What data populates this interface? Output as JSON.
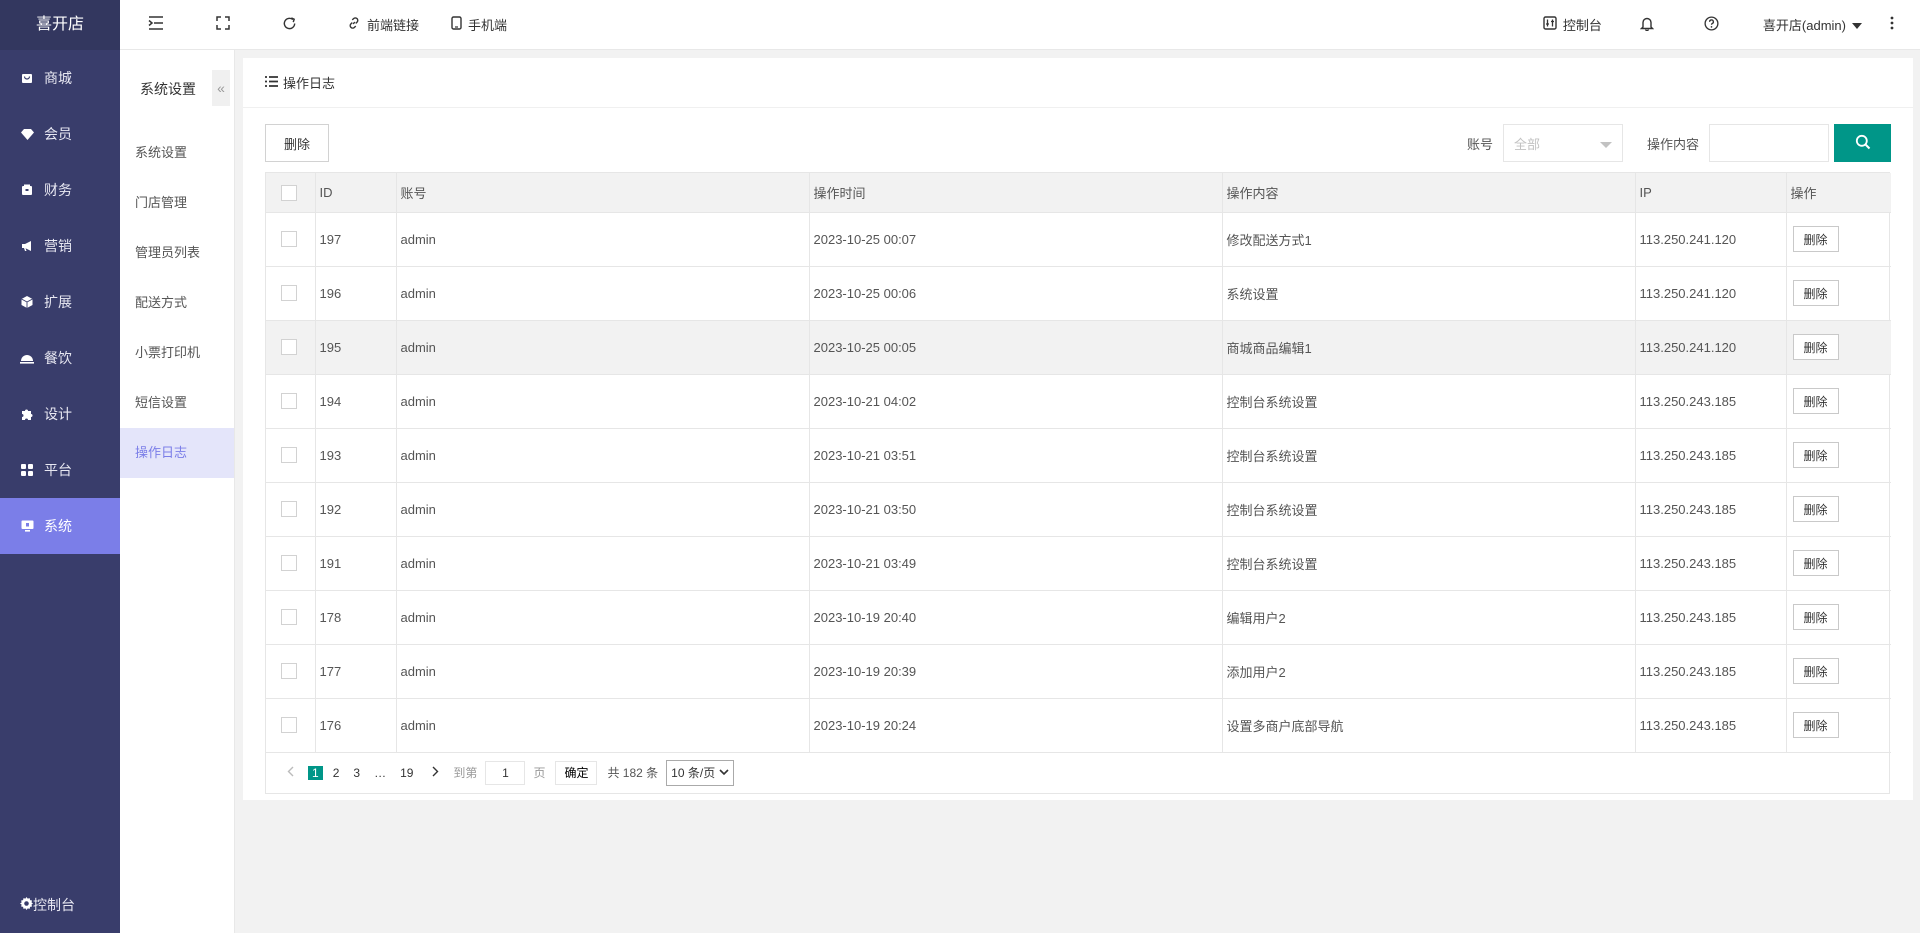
{
  "sidebar": {
    "brand": "喜开店",
    "items": [
      {
        "label": "商城",
        "icon": "shop-icon"
      },
      {
        "label": "会员",
        "icon": "diamond-icon"
      },
      {
        "label": "财务",
        "icon": "wallet-icon"
      },
      {
        "label": "营销",
        "icon": "megaphone-icon"
      },
      {
        "label": "扩展",
        "icon": "cube-icon"
      },
      {
        "label": "餐饮",
        "icon": "dish-icon"
      },
      {
        "label": "设计",
        "icon": "puzzle-icon"
      },
      {
        "label": "平台",
        "icon": "grid-icon"
      },
      {
        "label": "系统",
        "icon": "monitor-icon",
        "active": true
      }
    ],
    "bottom_label": "控制台"
  },
  "subnav": {
    "title": "系统设置",
    "collapse_glyph": "«",
    "items": [
      "系统设置",
      "门店管理",
      "管理员列表",
      "配送方式",
      "小票打印机",
      "短信设置",
      "操作日志"
    ],
    "active": "操作日志"
  },
  "topbar": {
    "frontend_link": "前端链接",
    "mobile": "手机端",
    "console": "控制台",
    "user": "喜开店(admin)"
  },
  "page": {
    "title": "操作日志",
    "delete_button": "删除",
    "filter_account_label": "账号",
    "filter_account_value": "全部",
    "filter_content_label": "操作内容"
  },
  "table": {
    "headers": [
      "",
      "ID",
      "账号",
      "操作时间",
      "操作内容",
      "IP",
      "操作"
    ],
    "row_action": "删除",
    "rows": [
      {
        "id": "197",
        "account": "admin",
        "time": "2023-10-25 00:07",
        "content": "修改配送方式1",
        "ip": "113.250.241.120"
      },
      {
        "id": "196",
        "account": "admin",
        "time": "2023-10-25 00:06",
        "content": "系统设置",
        "ip": "113.250.241.120"
      },
      {
        "id": "195",
        "account": "admin",
        "time": "2023-10-25 00:05",
        "content": "商城商品编辑1",
        "ip": "113.250.241.120"
      },
      {
        "id": "194",
        "account": "admin",
        "time": "2023-10-21 04:02",
        "content": "控制台系统设置",
        "ip": "113.250.243.185"
      },
      {
        "id": "193",
        "account": "admin",
        "time": "2023-10-21 03:51",
        "content": "控制台系统设置",
        "ip": "113.250.243.185"
      },
      {
        "id": "192",
        "account": "admin",
        "time": "2023-10-21 03:50",
        "content": "控制台系统设置",
        "ip": "113.250.243.185"
      },
      {
        "id": "191",
        "account": "admin",
        "time": "2023-10-21 03:49",
        "content": "控制台系统设置",
        "ip": "113.250.243.185"
      },
      {
        "id": "178",
        "account": "admin",
        "time": "2023-10-19 20:40",
        "content": "编辑用户2",
        "ip": "113.250.243.185"
      },
      {
        "id": "177",
        "account": "admin",
        "time": "2023-10-19 20:39",
        "content": "添加用户2",
        "ip": "113.250.243.185"
      },
      {
        "id": "176",
        "account": "admin",
        "time": "2023-10-19 20:24",
        "content": "设置多商户底部导航",
        "ip": "113.250.243.185"
      }
    ]
  },
  "pager": {
    "pages": [
      "1",
      "2",
      "3",
      "…",
      "19"
    ],
    "current": "1",
    "goto_label": "到第",
    "goto_value": "1",
    "page_unit": "页",
    "confirm": "确定",
    "total": "共 182 条",
    "page_size": "10 条/页"
  },
  "colors": {
    "sidebar": "#393d6b",
    "accent": "#7b7ee8",
    "primary": "#009688"
  }
}
